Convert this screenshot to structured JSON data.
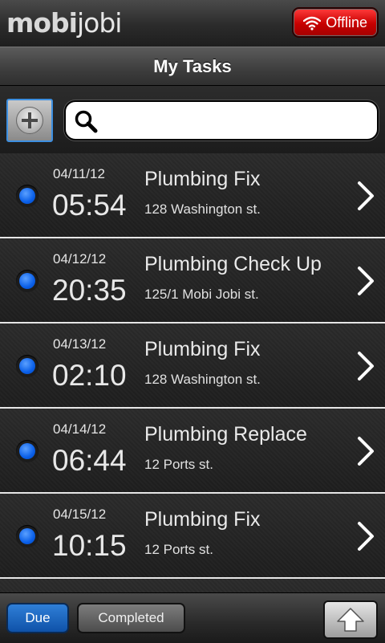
{
  "app": {
    "logo_part1": "mobi",
    "logo_part2": "jobi",
    "status_button": "Offline"
  },
  "header": {
    "title": "My Tasks"
  },
  "search": {
    "placeholder": "",
    "value": ""
  },
  "tasks": [
    {
      "date": "04/11/12",
      "time": "05:54",
      "title": "Plumbing Fix",
      "address": "128 Washington st."
    },
    {
      "date": "04/12/12",
      "time": "20:35",
      "title": "Plumbing Check Up",
      "address": "125/1 Mobi Jobi st."
    },
    {
      "date": "04/13/12",
      "time": "02:10",
      "title": "Plumbing Fix",
      "address": "128 Washington st."
    },
    {
      "date": "04/14/12",
      "time": "06:44",
      "title": "Plumbing Replace",
      "address": "12 Ports st."
    },
    {
      "date": "04/15/12",
      "time": "10:15",
      "title": "Plumbing Fix",
      "address": "12 Ports st."
    }
  ],
  "bottom": {
    "tab_due": "Due",
    "tab_completed": "Completed"
  },
  "colors": {
    "offline": "#d40000",
    "status_dot": "#0a5fe8",
    "due_tab": "#1f68c4"
  },
  "icons": {
    "status_icon": "wifi-icon",
    "add": "plus-icon",
    "search": "search-icon",
    "row_indicator": "status-dot-icon",
    "row_nav": "chevron-right-icon",
    "scroll_top": "arrow-up-icon"
  }
}
